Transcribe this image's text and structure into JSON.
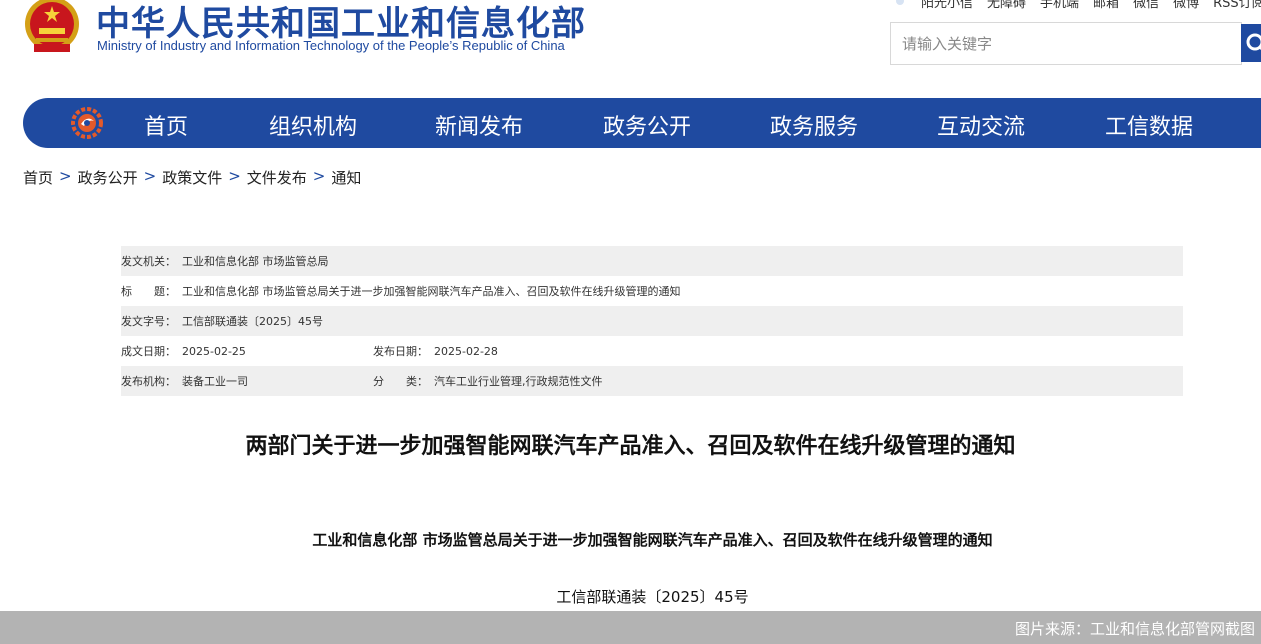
{
  "header": {
    "site_title": "中华人民共和国工业和信息化部",
    "site_subtitle": "Ministry of Industry and Information Technology of the People’s Republic of China",
    "emblem_icon": "national-emblem-icon",
    "top_links": [
      "阳光小信",
      "无障碍",
      "手机端",
      "邮箱",
      "微信",
      "微博",
      "RSS订阅"
    ],
    "search_placeholder": "请输入关键字",
    "search_icon": "search-icon"
  },
  "nav": {
    "logo_icon": "gear-logo-icon",
    "items": [
      "首页",
      "组织机构",
      "新闻发布",
      "政务公开",
      "政务服务",
      "互动交流",
      "工信数据"
    ]
  },
  "breadcrumb": {
    "items": [
      "首页",
      "政务公开",
      "政策文件",
      "文件发布",
      "通知"
    ],
    "separator": ">"
  },
  "meta": {
    "issuer_label": "发文机关：",
    "issuer_value": "工业和信息化部 市场监管总局",
    "title_label": "标　　题：",
    "title_value": "工业和信息化部 市场监管总局关于进一步加强智能网联汽车产品准入、召回及软件在线升级管理的通知",
    "doc_no_label": "发文字号：",
    "doc_no_value": "工信部联通装〔2025〕45号",
    "created_label": "成文日期：",
    "created_value": "2025-02-25",
    "published_label": "发布日期：",
    "published_value": "2025-02-28",
    "org_label": "发布机构：",
    "org_value": "装备工业一司",
    "category_label": "分　　类：",
    "category_value": "汽车工业行业管理,行政规范性文件"
  },
  "article": {
    "title": "两部门关于进一步加强智能网联汽车产品准入、召回及软件在线升级管理的通知",
    "doc_title": "工业和信息化部 市场监管总局关于进一步加强智能网联汽车产品准入、召回及软件在线升级管理的通知",
    "doc_number": "工信部联通装〔2025〕45号"
  },
  "caption": {
    "text": "图片来源：工业和信息化部管网截图"
  },
  "colors": {
    "brand_blue": "#1f4aa0",
    "row_shade": "#efefef",
    "caption_bar": "#b3b3b3"
  }
}
